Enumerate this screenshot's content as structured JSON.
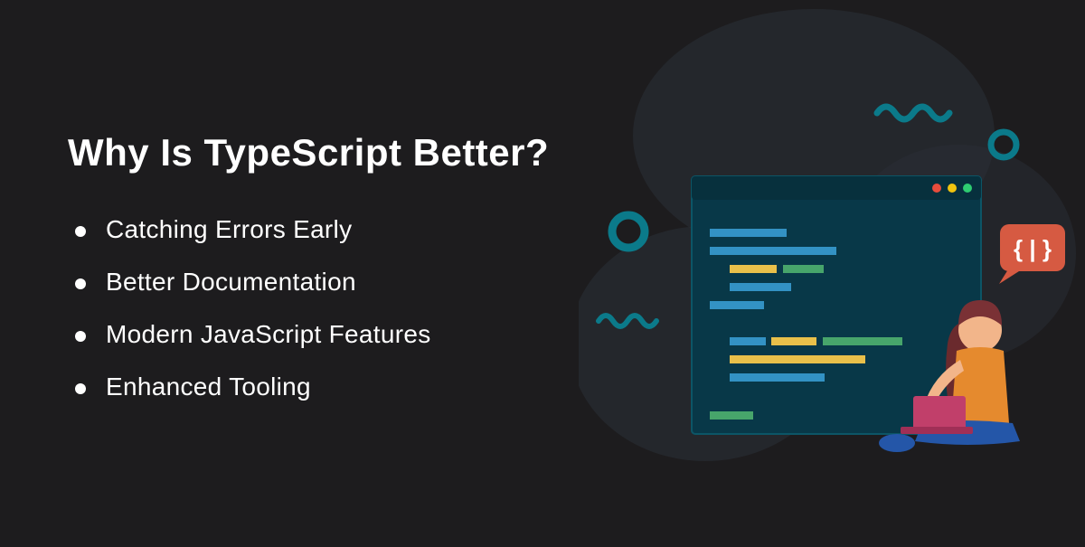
{
  "title": "Why Is TypeScript Better?",
  "bullets": [
    "Catching Errors Early",
    "Better Documentation",
    "Modern JavaScript Features",
    "Enhanced Tooling"
  ],
  "speech_bubble": "{ | }"
}
